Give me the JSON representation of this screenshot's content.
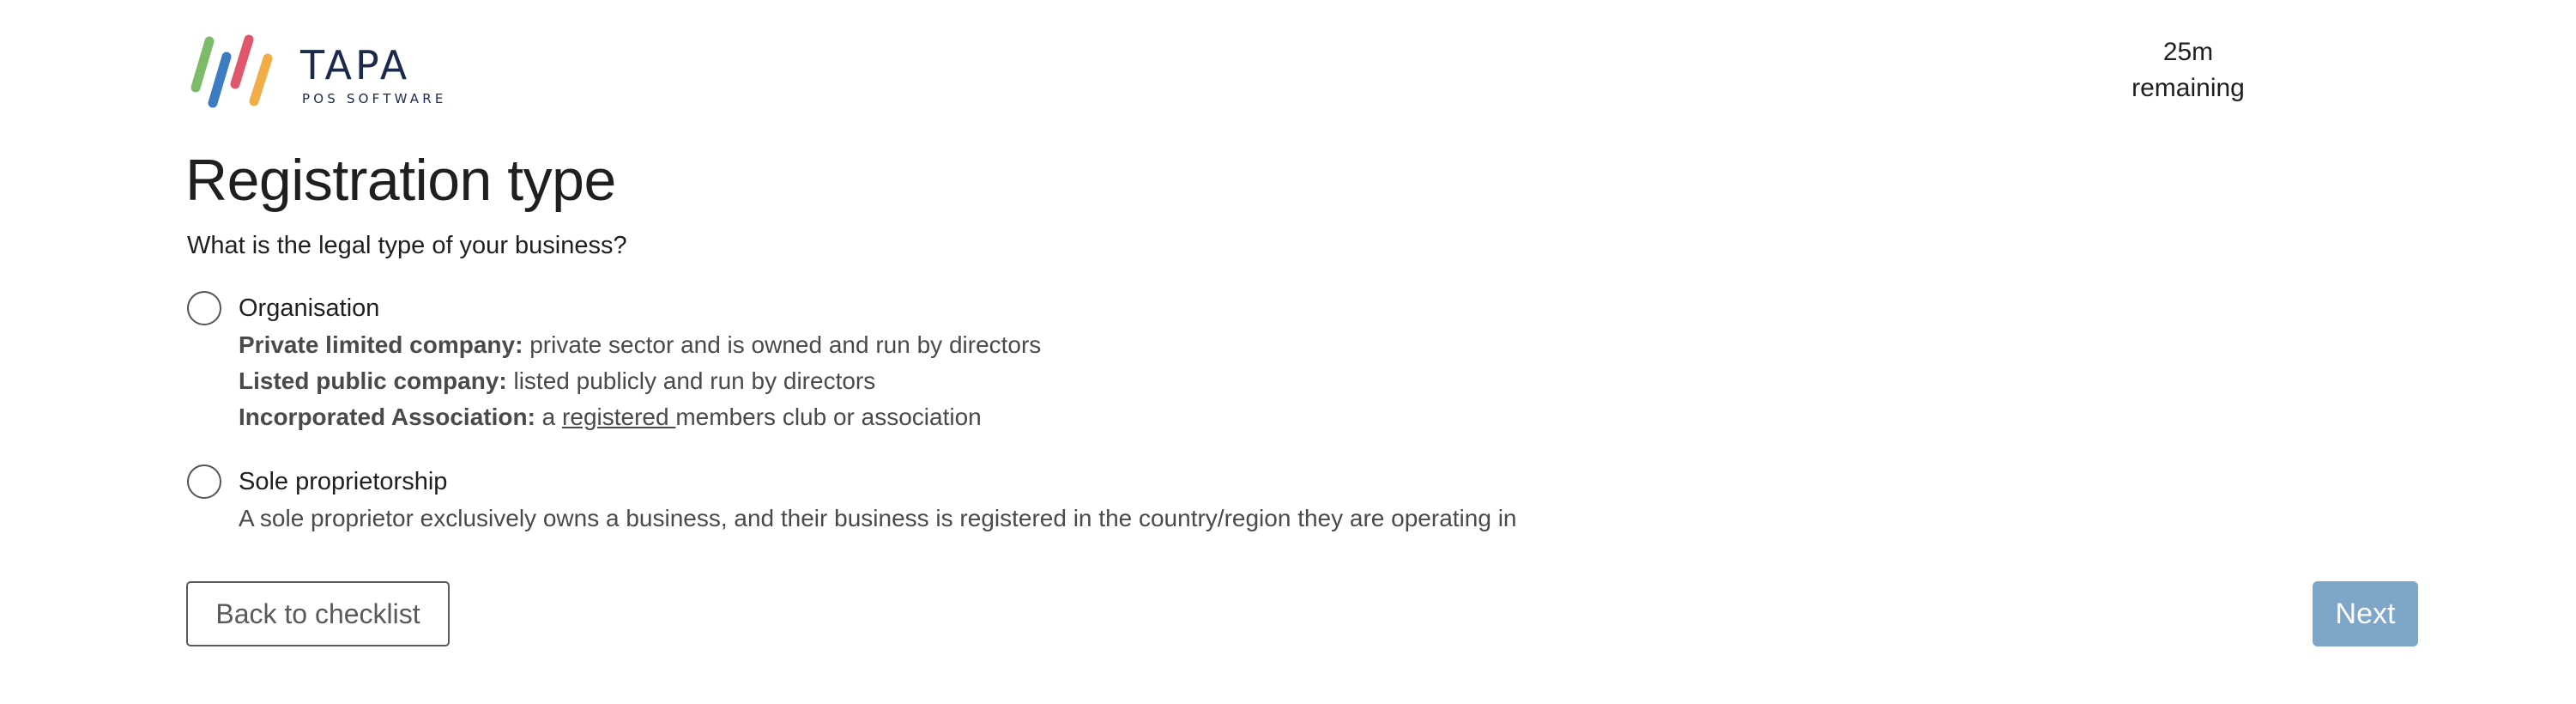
{
  "header": {
    "logo": {
      "name": "TAPA",
      "subtitle": "POS SOFTWARE",
      "stripe_colors": [
        "#7dbb6b",
        "#3d7cc0",
        "#e2566b",
        "#f0ad48"
      ]
    },
    "timer": {
      "value": "25m",
      "label": "remaining"
    }
  },
  "main": {
    "title": "Registration type",
    "question": "What is the legal type of your business?",
    "options": [
      {
        "label": "Organisation",
        "selected": false,
        "descriptions": [
          {
            "term": "Private limited company:",
            "text": " private sector and is owned and run by directors"
          },
          {
            "term": "Listed public company:",
            "text": " listed publicly and run by directors"
          },
          {
            "term": "Incorporated Association:",
            "text_before": " a ",
            "link": "registered ",
            "text_after": "members club or association"
          }
        ]
      },
      {
        "label": "Sole proprietorship",
        "selected": false,
        "description": "A sole proprietor exclusively owns a business, and their business is registered in the country/region they are operating in"
      }
    ]
  },
  "actions": {
    "back_label": "Back to checklist",
    "next_label": "Next",
    "next_color": "#7ea6c8"
  }
}
